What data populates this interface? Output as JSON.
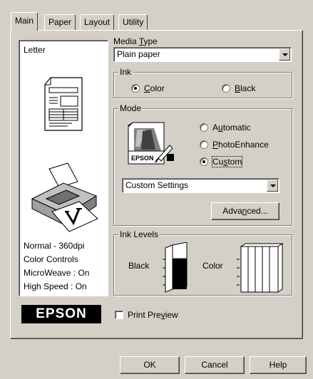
{
  "tabs": [
    {
      "label": "Main"
    },
    {
      "label": "Paper"
    },
    {
      "label": "Layout"
    },
    {
      "label": "Utility"
    }
  ],
  "preview": {
    "paper_size": "Letter",
    "status_lines": [
      "Normal - 360dpi",
      "Color Controls",
      "MicroWeave : On",
      "High Speed : On"
    ]
  },
  "media_type": {
    "label_pre": "Media ",
    "label_key": "T",
    "label_post": "ype",
    "value": "Plain paper"
  },
  "ink": {
    "legend": "Ink",
    "color": {
      "key": "C",
      "rest": "olor",
      "selected": true
    },
    "black": {
      "key": "B",
      "rest": "lack",
      "selected": false
    }
  },
  "mode": {
    "legend": "Mode",
    "icon_brand": "EPSON",
    "automatic": {
      "pre": "A",
      "key": "u",
      "rest": "tomatic",
      "selected": false
    },
    "photoenhance": {
      "key": "P",
      "rest": "hotoEnhance",
      "selected": false
    },
    "custom": {
      "pre": "Cu",
      "key": "s",
      "rest": "tom",
      "selected": true
    },
    "custom_settings": "Custom Settings",
    "advanced": {
      "pre": "Adva",
      "key": "n",
      "rest": "ced..."
    }
  },
  "ink_levels": {
    "legend": "Ink Levels",
    "black_label": "Black",
    "color_label": "Color",
    "black_level": 0.7,
    "color_levels": [
      0.0,
      0.0,
      0.0,
      0.0,
      0.0
    ]
  },
  "logo": "EPSON",
  "print_preview": {
    "pre": "Print Pre",
    "key": "v",
    "rest": "iew",
    "checked": false
  },
  "footer": {
    "ok": "OK",
    "cancel": "Cancel",
    "help": "Help"
  },
  "colors": {
    "face": "#d4d0c8",
    "shadow": "#808080",
    "highlight": "#ffffff"
  }
}
